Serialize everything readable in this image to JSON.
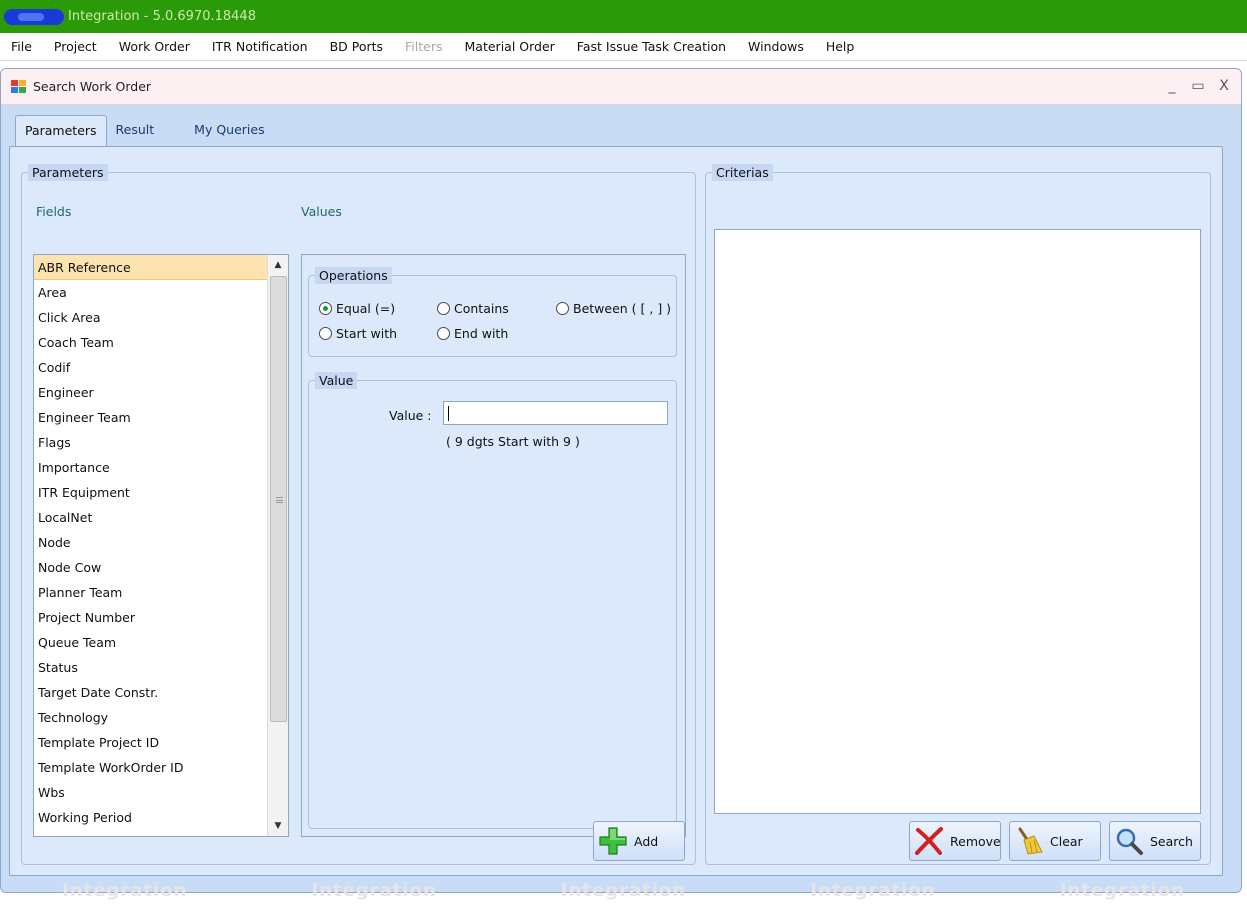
{
  "app": {
    "title": "Integration - 5.0.6970.18448"
  },
  "menu": {
    "items": [
      {
        "label": "File",
        "enabled": true
      },
      {
        "label": "Project",
        "enabled": true
      },
      {
        "label": "Work Order",
        "enabled": true
      },
      {
        "label": "ITR Notification",
        "enabled": true
      },
      {
        "label": "BD Ports",
        "enabled": true
      },
      {
        "label": "Filters",
        "enabled": false
      },
      {
        "label": "Material Order",
        "enabled": true
      },
      {
        "label": "Fast Issue Task Creation",
        "enabled": true
      },
      {
        "label": "Windows",
        "enabled": true
      },
      {
        "label": "Help",
        "enabled": true
      }
    ]
  },
  "window": {
    "title": "Search Work Order",
    "controls": {
      "minimize": "_",
      "maximize": "▭",
      "close": "X"
    }
  },
  "tabs": [
    {
      "label": "Parameters",
      "active": true
    },
    {
      "label": "Result",
      "active": false
    },
    {
      "label": "My Queries",
      "active": false
    }
  ],
  "parameters": {
    "legend": "Parameters",
    "fields_label": "Fields",
    "values_label": "Values",
    "fields": [
      "ABR Reference",
      "Area",
      "Click Area",
      "Coach Team",
      "Codif",
      "Engineer",
      "Engineer Team",
      "Flags",
      "Importance",
      "ITR Equipment",
      "LocalNet",
      "Node",
      "Node Cow",
      "Planner Team",
      "Project Number",
      "Queue Team",
      "Status",
      "Target Date Constr.",
      "Technology",
      "Template Project ID",
      "Template WorkOrder ID",
      "Wbs",
      "Working Period"
    ],
    "selected_field": "ABR Reference",
    "operations": {
      "legend": "Operations",
      "options": [
        {
          "label": "Equal (=)",
          "checked": true
        },
        {
          "label": "Contains",
          "checked": false
        },
        {
          "label": "Between ( [ , ] )",
          "checked": false
        },
        {
          "label": "Start with",
          "checked": false
        },
        {
          "label": "End with",
          "checked": false
        }
      ]
    },
    "value": {
      "legend": "Value",
      "label": "Value :",
      "input_value": "",
      "hint": "( 9 dgts Start with 9 )"
    },
    "add_label": "Add"
  },
  "criterias": {
    "legend": "Criterias",
    "items": [],
    "remove_label": "Remove",
    "clear_label": "Clear",
    "search_label": "Search"
  },
  "watermark": {
    "text": "Integration"
  },
  "colors": {
    "titlebar": "#2a9a08",
    "accent_blue": "#c9dcf6",
    "selection": "#fde3b0"
  }
}
